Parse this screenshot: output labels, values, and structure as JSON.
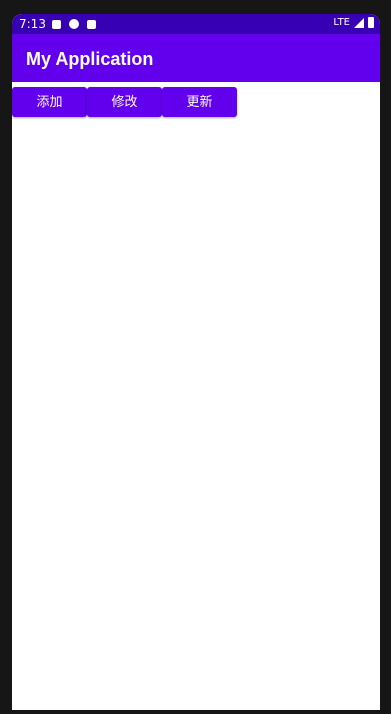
{
  "status_bar": {
    "time": "7:13",
    "icons_left": [
      "a-icon",
      "location-icon",
      "sd-card-icon"
    ],
    "network": "LTE",
    "colors": {
      "background": "#3700b3"
    }
  },
  "app_bar": {
    "title": "My Application",
    "color": "#6200ee"
  },
  "buttons": [
    {
      "label": "添加"
    },
    {
      "label": "修改"
    },
    {
      "label": "更新"
    }
  ]
}
